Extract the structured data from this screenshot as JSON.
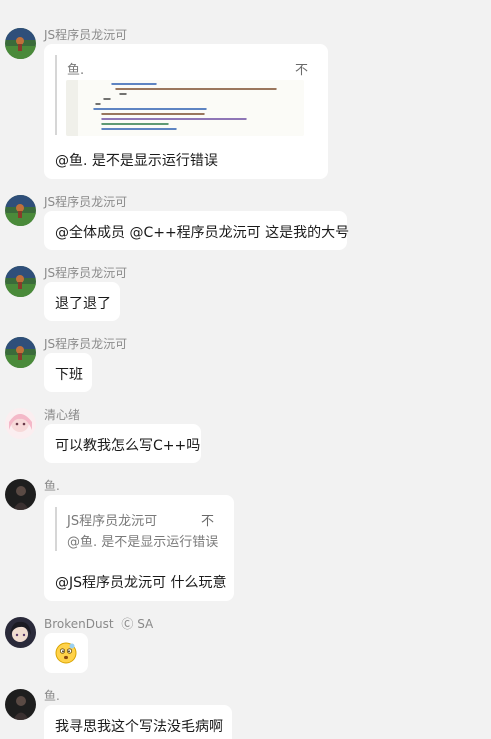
{
  "messages": [
    {
      "sender": "JS程序员龙沅可",
      "avatar_icon": "landscape-avatar-icon",
      "quote": {
        "author": "鱼.",
        "attachment": "code-screenshot-image"
      },
      "text": "@鱼. 是不是显示运行错误"
    },
    {
      "sender": "JS程序员龙沅可",
      "avatar_icon": "landscape-avatar-icon",
      "text": "@全体成员 @C++程序员龙沅可 这是我的大号"
    },
    {
      "sender": "JS程序员龙沅可",
      "avatar_icon": "landscape-avatar-icon",
      "text": "退了退了"
    },
    {
      "sender": "JS程序员龙沅可",
      "avatar_icon": "landscape-avatar-icon",
      "text": "下班"
    },
    {
      "sender": "清心绪",
      "avatar_icon": "anime-girl-avatar-icon",
      "text": "可以教我怎么写C++吗"
    },
    {
      "sender": "鱼.",
      "avatar_icon": "dark-avatar-icon",
      "quote": {
        "author": "JS程序员龙沅可",
        "text": "@鱼. 是不是显示运行错误"
      },
      "text": "@JS程序员龙沅可 什么玩意"
    },
    {
      "sender": "BrokenDust",
      "sender_badge": "Ⓒ SA",
      "avatar_icon": "anime-boy-avatar-icon",
      "emoji": "confused-face-emoji"
    },
    {
      "sender": "鱼.",
      "avatar_icon": "dark-avatar-icon",
      "text": "我寻思我这个写法没毛病啊"
    }
  ],
  "quote_mark": "不",
  "colors": {
    "background": "#f2f2f2",
    "bubble": "#ffffff",
    "sender_name": "#8a8a8a",
    "text": "#1a1a1a"
  }
}
